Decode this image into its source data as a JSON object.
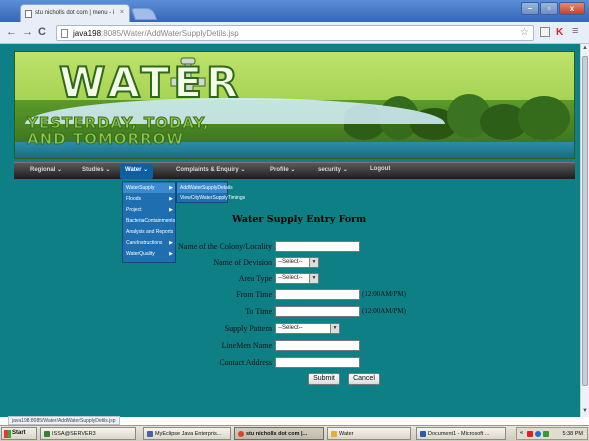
{
  "browser": {
    "tab_title": "stu nicholls dot com | menu - i",
    "tab_close": "×",
    "address_host": "java198",
    "address_path": ":8085/Water/AddWaterSupplyDetils.jsp",
    "back_glyph": "←",
    "forward_glyph": "→",
    "reload_glyph": "C",
    "star_glyph": "☆",
    "menu_glyph": "≡",
    "window_buttons": [
      "–",
      "▫",
      "x"
    ]
  },
  "banner": {
    "title": "WATER",
    "subtitle_line1": "YESTERDAY, TODAY,",
    "subtitle_line2": "AND TOMORROW"
  },
  "menubar": {
    "items": [
      {
        "label": "Regional",
        "active": false
      },
      {
        "label": "Studies",
        "active": false
      },
      {
        "label": "Water",
        "active": true
      },
      {
        "label": "Complaints & Enquiry",
        "active": false
      },
      {
        "label": "Profile",
        "active": false
      },
      {
        "label": "security",
        "active": false
      },
      {
        "label": "Logout",
        "active": false
      }
    ],
    "caret": "⌄"
  },
  "water_menu": {
    "items": [
      {
        "label": "WaterSupply",
        "has_sub": true,
        "hover": true
      },
      {
        "label": "Floods",
        "has_sub": true,
        "hover": false
      },
      {
        "label": "Project",
        "has_sub": true,
        "hover": false
      },
      {
        "label": "BacteriaContainments",
        "has_sub": false,
        "hover": false
      },
      {
        "label": "Analysis and Reports",
        "has_sub": false,
        "hover": false
      },
      {
        "label": "CareInstructions",
        "has_sub": true,
        "hover": false
      },
      {
        "label": "WaterQuality",
        "has_sub": true,
        "hover": false
      }
    ],
    "sub_items": [
      {
        "label": "AddWaterSupplyDetails",
        "hover": true
      },
      {
        "label": "ViewCityWaterSupplyTimings",
        "hover": false
      }
    ],
    "arrow": "▶"
  },
  "form": {
    "title": "Water Supply Entry Form",
    "colony_label": "Name of the Colony/Locality",
    "division_label": "Name of Devision",
    "division_value": "--Select--",
    "area_label": "Area Type",
    "area_value": "--Select--",
    "from_label": "From Time",
    "from_hint": "(12:00AM/PM)",
    "to_label": "To Time",
    "to_hint": "(12:00AM/PM)",
    "pattern_label": "Supply Pattern",
    "pattern_value": "--Select--",
    "linemen_label": "LineMen Name",
    "contact_label": "Contact Address",
    "submit_label": "Submit",
    "cancel_label": "Cancel"
  },
  "statusbar": {
    "text": "java198:8085/Water/AddWaterSupplyDetils.jsp"
  },
  "taskbar": {
    "start_label": "Start",
    "tasks": [
      {
        "label": "ISSA@SERVER3",
        "active": false,
        "color": "#3b7d3b"
      },
      {
        "label": "MyEclipse Java Enterpris...",
        "active": false,
        "color": "#4a5fa8"
      },
      {
        "label": "stu nicholls dot com |...",
        "active": true,
        "color": "#d8452b"
      },
      {
        "label": "Water",
        "active": false,
        "color": "#e0b13a"
      },
      {
        "label": "Document1 - Microsoft ...",
        "active": false,
        "color": "#2b5ba8"
      }
    ],
    "clock": "5:38 PM",
    "tray_prefix": "«"
  }
}
